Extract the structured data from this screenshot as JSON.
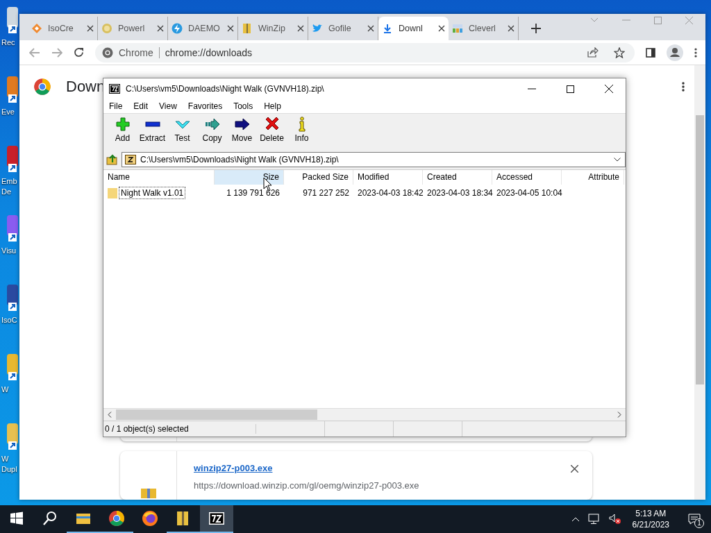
{
  "desktop": {
    "icons": [
      {
        "kind": "bin",
        "lines": [
          "Rec"
        ]
      },
      {
        "kind": "orange",
        "lines": [
          "Eve"
        ]
      },
      {
        "kind": "red",
        "lines": [
          "Emb",
          "De"
        ]
      },
      {
        "kind": "purple",
        "lines": [
          "Visu"
        ]
      },
      {
        "kind": "disc",
        "lines": [
          "IsoC"
        ]
      },
      {
        "kind": "yellow",
        "lines": [
          "W"
        ]
      },
      {
        "kind": "folder",
        "lines": [
          "W",
          "Dupl"
        ]
      }
    ]
  },
  "browser": {
    "tabs": [
      {
        "title": "IsoCre",
        "kind": "diamond",
        "selected": false
      },
      {
        "title": "Powerl",
        "kind": "coin",
        "selected": false
      },
      {
        "title": "DAEMO",
        "kind": "bolt",
        "selected": false
      },
      {
        "title": "WinZip",
        "kind": "archive",
        "selected": false
      },
      {
        "title": "Gofile",
        "kind": "bird",
        "selected": false
      },
      {
        "title": "Downl",
        "kind": "download",
        "selected": true
      },
      {
        "title": "Cleverl",
        "kind": "grid",
        "selected": false
      }
    ],
    "omnibox": {
      "chip": "Chrome",
      "url": "chrome://downloads"
    },
    "page": {
      "heading": "Down",
      "downloads": [
        {
          "file": "winzip27-p003.exe",
          "url": "https://download.winzip.com/gl/oemg/winzip27-p003.exe"
        }
      ]
    }
  },
  "archiver": {
    "title": "C:\\Users\\vm5\\Downloads\\Night Walk (GVNVH18).zip\\",
    "menu": [
      "File",
      "Edit",
      "View",
      "Favorites",
      "Tools",
      "Help"
    ],
    "toolbar": [
      {
        "label": "Add",
        "kind": "add"
      },
      {
        "label": "Extract",
        "kind": "extract"
      },
      {
        "label": "Test",
        "kind": "test"
      },
      {
        "label": "Copy",
        "kind": "copy"
      },
      {
        "label": "Move",
        "kind": "move"
      },
      {
        "label": "Delete",
        "kind": "delete"
      },
      {
        "label": "Info",
        "kind": "info"
      }
    ],
    "path": "C:\\Users\\vm5\\Downloads\\Night Walk (GVNVH18).zip\\",
    "columns": [
      {
        "label": "Name",
        "hovered": false
      },
      {
        "label": "Size",
        "hovered": true
      },
      {
        "label": "Packed Size",
        "hovered": false
      },
      {
        "label": "Modified",
        "hovered": false
      },
      {
        "label": "Created",
        "hovered": false
      },
      {
        "label": "Accessed",
        "hovered": false
      },
      {
        "label": "Attribute",
        "hovered": false
      }
    ],
    "rows": [
      {
        "kind": "folder",
        "focused": true,
        "cells": [
          "Night Walk v1.01",
          "1 139 791 626",
          "971 227 252",
          "2023-04-03 18:42",
          "2023-04-03 18:34",
          "2023-04-05 10:04"
        ]
      }
    ],
    "status": "0 / 1 object(s) selected"
  },
  "taskbar": {
    "items": [
      {
        "kind": "start",
        "running": false,
        "active": false
      },
      {
        "kind": "search",
        "running": false,
        "active": false
      },
      {
        "kind": "explorer",
        "running": true,
        "active": false
      },
      {
        "kind": "chrome",
        "running": true,
        "active": false
      },
      {
        "kind": "firefox",
        "running": false,
        "active": false
      },
      {
        "kind": "winzip",
        "running": true,
        "active": false
      },
      {
        "kind": "sevenzip",
        "running": true,
        "active": true
      }
    ],
    "time": "5:13 AM",
    "date": "6/21/2023",
    "notifications": "1"
  }
}
